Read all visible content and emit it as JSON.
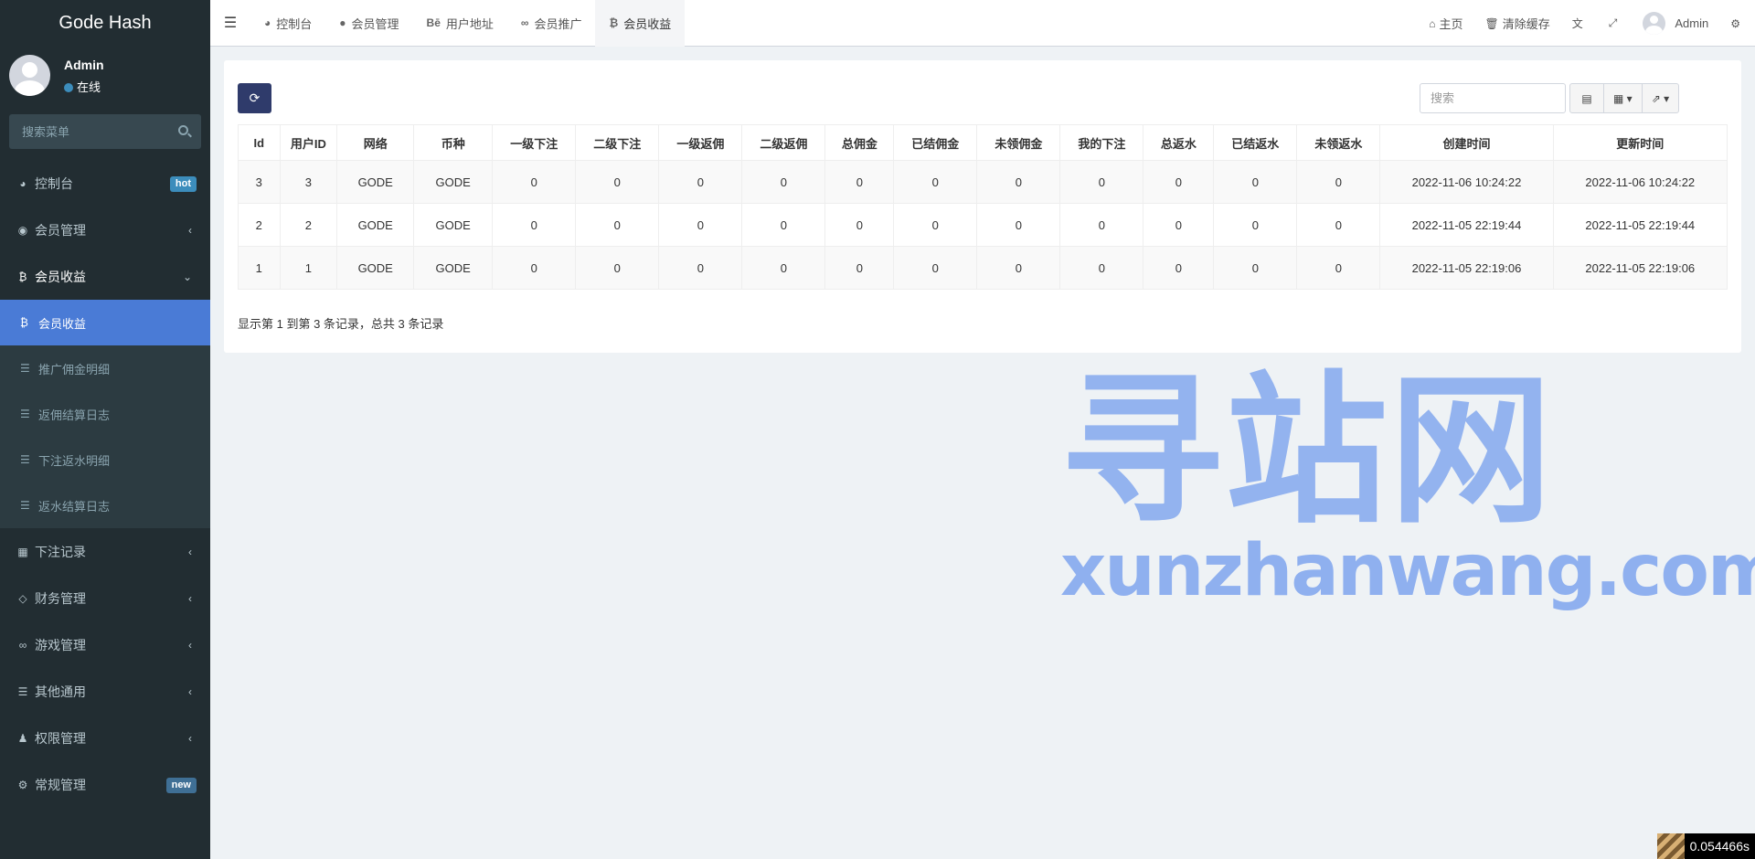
{
  "app": {
    "brand": "Gode Hash"
  },
  "user": {
    "name": "Admin",
    "status": "在线"
  },
  "sidebar_search": {
    "placeholder": "搜索菜单"
  },
  "menu": {
    "dashboard": {
      "label": "控制台",
      "badge": "hot"
    },
    "members": {
      "label": "会员管理"
    },
    "earnings": {
      "label": "会员收益",
      "children": [
        "会员收益",
        "推广佣金明细",
        "返佣结算日志",
        "下注返水明细",
        "返水结算日志"
      ]
    },
    "bets": {
      "label": "下注记录"
    },
    "finance": {
      "label": "财务管理"
    },
    "games": {
      "label": "游戏管理"
    },
    "other": {
      "label": "其他通用"
    },
    "permissions": {
      "label": "权限管理"
    },
    "general": {
      "label": "常规管理",
      "badge": "new"
    }
  },
  "tabs": [
    "控制台",
    "会员管理",
    "用户地址",
    "会员推广",
    "会员收益"
  ],
  "nav_right": {
    "home": "主页",
    "clear_cache": "清除缓存",
    "user": "Admin"
  },
  "toolbar": {
    "search_placeholder": "搜索"
  },
  "table": {
    "headers": [
      "Id",
      "用户ID",
      "网络",
      "币种",
      "一级下注",
      "二级下注",
      "一级返佣",
      "二级返佣",
      "总佣金",
      "已结佣金",
      "未领佣金",
      "我的下注",
      "总返水",
      "已结返水",
      "未领返水",
      "创建时间",
      "更新时间"
    ],
    "rows": [
      [
        "3",
        "3",
        "GODE",
        "GODE",
        "0",
        "0",
        "0",
        "0",
        "0",
        "0",
        "0",
        "0",
        "0",
        "0",
        "0",
        "2022-11-06 10:24:22",
        "2022-11-06 10:24:22"
      ],
      [
        "2",
        "2",
        "GODE",
        "GODE",
        "0",
        "0",
        "0",
        "0",
        "0",
        "0",
        "0",
        "0",
        "0",
        "0",
        "0",
        "2022-11-05 22:19:44",
        "2022-11-05 22:19:44"
      ],
      [
        "1",
        "1",
        "GODE",
        "GODE",
        "0",
        "0",
        "0",
        "0",
        "0",
        "0",
        "0",
        "0",
        "0",
        "0",
        "0",
        "2022-11-05 22:19:06",
        "2022-11-05 22:19:06"
      ]
    ]
  },
  "pager_info": "显示第 1 到第 3 条记录，总共 3 条记录",
  "watermark": {
    "cn": "寻站网",
    "en": "xunzhanwang.com"
  },
  "timer": "0.054466s"
}
